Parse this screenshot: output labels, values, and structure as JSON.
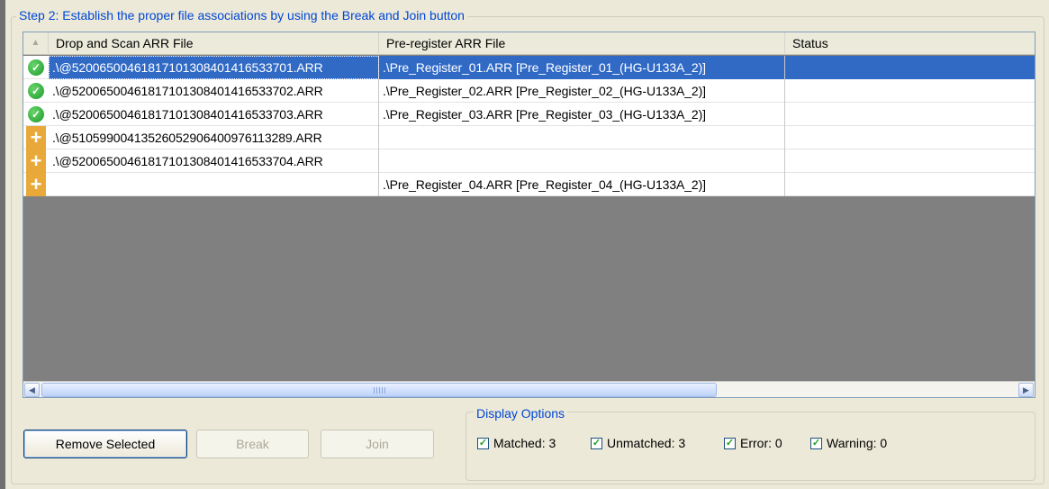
{
  "step_group": {
    "legend": "Step 2: Establish the proper file associations by using the Break and Join button"
  },
  "grid": {
    "sort_glyph": "▲",
    "columns": {
      "drop": "Drop and Scan ARR File",
      "prereg": "Pre-register ARR File",
      "status": "Status"
    },
    "rows": [
      {
        "icon": "matched",
        "drop": ".\\@520065004618171013084014165337​01.ARR",
        "prereg": ".\\Pre_Register_01.ARR [Pre_Register_01_(HG-U133A_2)]",
        "status": "",
        "selected": true
      },
      {
        "icon": "matched",
        "drop": ".\\@52006500461817101308401416533702.ARR",
        "prereg": ".\\Pre_Register_02.ARR [Pre_Register_02_(HG-U133A_2)]",
        "status": ""
      },
      {
        "icon": "matched",
        "drop": ".\\@52006500461817101308401416533703.ARR",
        "prereg": ".\\Pre_Register_03.ARR [Pre_Register_03_(HG-U133A_2)]",
        "status": ""
      },
      {
        "icon": "unmatched",
        "drop": ".\\@51059900413526052906400976113289.ARR",
        "prereg": "",
        "status": ""
      },
      {
        "icon": "unmatched",
        "drop": ".\\@52006500461817101308401416533704.ARR",
        "prereg": "",
        "status": ""
      },
      {
        "icon": "unmatched",
        "drop": "",
        "prereg": ".\\Pre_Register_04.ARR [Pre_Register_04_(HG-U133A_2)]",
        "status": ""
      }
    ],
    "scroll_left_glyph": "◀",
    "scroll_right_glyph": "▶"
  },
  "buttons": {
    "remove_selected": "Remove Selected",
    "break": "Break",
    "join": "Join"
  },
  "display_options": {
    "legend": "Display Options",
    "check_glyph": "✓",
    "matched": "Matched: 3",
    "unmatched": "Unmatched: 3",
    "error": "Error: 0",
    "warning": "Warning: 0"
  },
  "icons": {
    "matched": "check-circle-icon",
    "unmatched": "plus-icon"
  },
  "colors": {
    "selection": "#316ac5",
    "legend_text": "#0046d5",
    "matched_icon": "#1c9a2e",
    "unmatched_icon": "#e8a93a",
    "grid_background": "#808080"
  }
}
